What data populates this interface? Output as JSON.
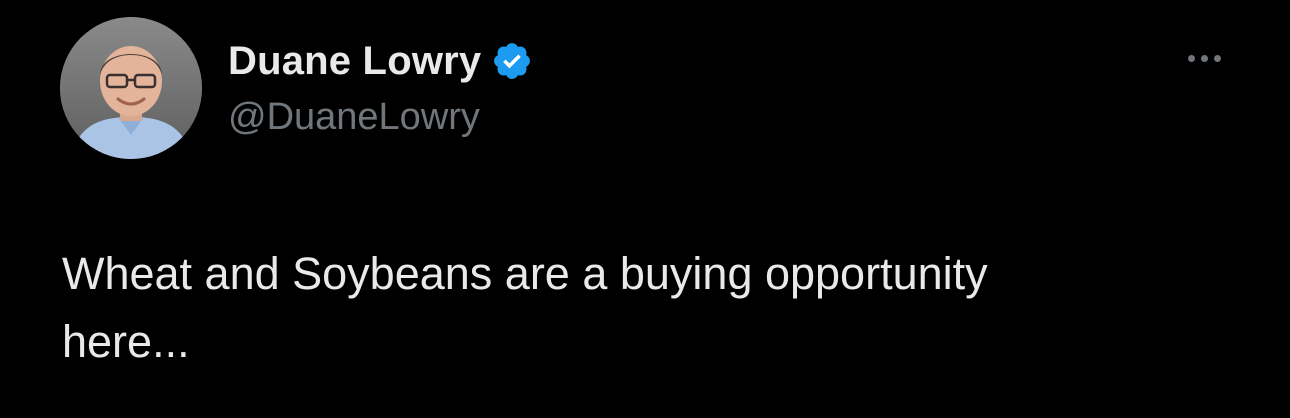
{
  "author": {
    "display_name": "Duane Lowry",
    "handle": "@DuaneLowry",
    "avatar_icon": "profile-photo",
    "verified_icon": "verified-badge-icon",
    "verified_color": "#1d9bf0"
  },
  "menu": {
    "icon": "more-options-icon"
  },
  "tweet": {
    "text": "Wheat and Soybeans are a buying opportunity\nhere..."
  },
  "colors": {
    "background": "#000000",
    "primary_text": "#e7e9ea",
    "secondary_text": "#71767b"
  }
}
